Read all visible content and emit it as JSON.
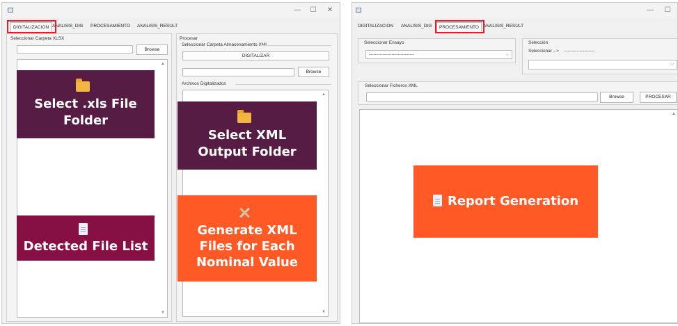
{
  "left_window": {
    "tabs": [
      "DIGITALIZACION",
      "ANALISIS_DIG",
      "PROCESAMIENTO",
      "ANALISIS_RESULT"
    ],
    "active_tab": "DIGITALIZACION",
    "xlsx_group_label": "Seleccionar Carpeta XLSX",
    "browse_label": "Browse",
    "procesar_group_label": "Procesar",
    "xml_storage_label": "Seleccionar Carpeta Almacenamiento XML",
    "digitalizar_label": "DIGITALIZAR",
    "browse2_label": "Browse",
    "archivos_label": "Archivos Digitalizados"
  },
  "right_window": {
    "tabs": [
      "DIGITALIZACION",
      "ANALISIS_DIG",
      "PROCESAMIENTO",
      "ANALISIS_RESULT"
    ],
    "active_tab": "PROCESAMIENTO",
    "ensayo_label": "Seleccionar Ensayo",
    "ensayo_value": "------------------------------",
    "seleccion_label": "Selección",
    "seleccionar_text": "Seleccionar -->",
    "seleccionar_dashes": "--------------------",
    "ficheros_label": "Seleccionar Ficheros XML",
    "browse_label": "Browse",
    "procesar_label": "PROCESAR"
  },
  "window_controls": {
    "minimize": "—",
    "maximize": "☐",
    "close": "✕"
  },
  "annotations": {
    "select_xls": "Select .xls File Folder",
    "detected_list": "Detected File List",
    "select_xml": "Select XML Output Folder",
    "generate_xml": "Generate XML Files for Each Nominal Value",
    "report": "Report Generation"
  },
  "colors": {
    "plum": "#571c43",
    "crimson": "#861043",
    "orange": "#ff5a26",
    "highlight": "#e31e24"
  }
}
